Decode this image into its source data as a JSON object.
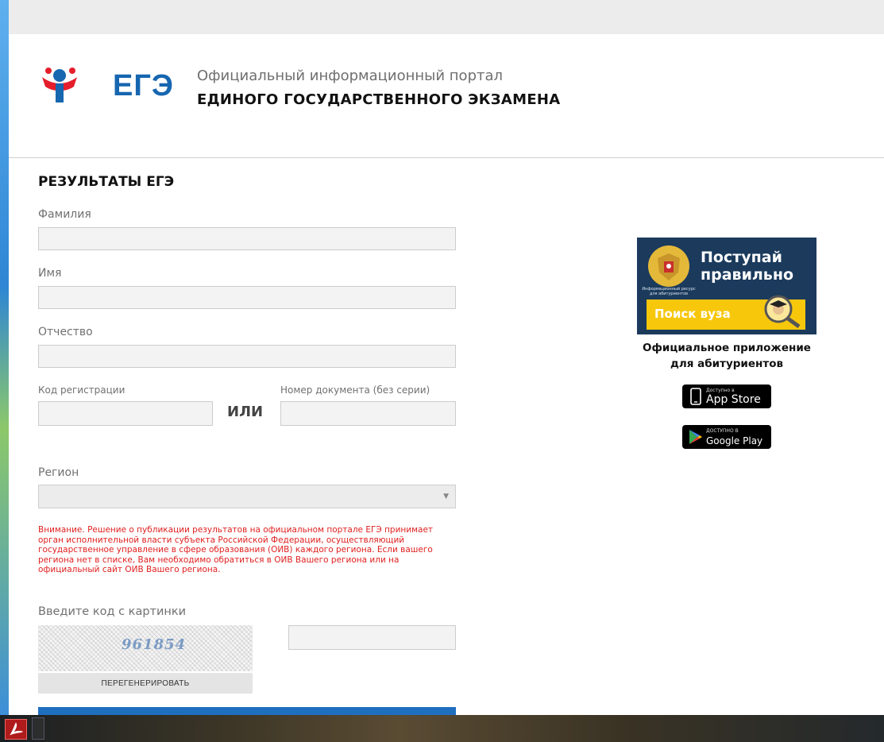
{
  "header": {
    "logo_text": "ЕГЭ",
    "portal_line1": "Официальный информационный портал",
    "portal_line2": "ЕДИНОГО ГОСУДАРСТВЕННОГО ЭКЗАМЕНА"
  },
  "form": {
    "title": "РЕЗУЛЬТАТЫ ЕГЭ",
    "surname_label": "Фамилия",
    "surname_value": "",
    "name_label": "Имя",
    "name_value": "",
    "patronymic_label": "Отчество",
    "patronymic_value": "",
    "reg_code_label": "Код регистрации",
    "reg_code_value": "",
    "or_text": "ИЛИ",
    "doc_number_label": "Номер документа (без серии)",
    "doc_number_value": "",
    "region_label": "Регион",
    "region_selected": "",
    "warning": "Внимание. Решение о публикации результатов на официальном портале ЕГЭ принимает орган исполнительной власти субъекта Российской Федерации, осуществляющий государственное управление в сфере образования (ОИВ) каждого региона. Если вашего региона нет в списке, Вам необходимо обратиться в ОИВ Вашего региона или на официальный сайт ОИВ Вашего региона.",
    "captcha_label": "Введите код с картинки",
    "captcha_code": "961854",
    "captcha_value": "",
    "regenerate_label": "ПЕРЕГЕНЕРИРОВАТЬ"
  },
  "sidebar": {
    "banner_title_line1": "Поступай",
    "banner_title_line2": "правильно",
    "banner_emblem_text": "Информационный ресурс для абитуриентов",
    "banner_button": "Поиск вуза",
    "app_caption_line1": "Официальное приложение",
    "app_caption_line2": "для абитуриентов",
    "appstore_small": "Доступно в",
    "appstore_big": "App Store",
    "googleplay_small": "ДОСТУПНО В",
    "googleplay_big": "Google Play"
  },
  "colors": {
    "brand_blue": "#1666b0",
    "brand_red": "#e41e2b",
    "warning_red": "#e02020",
    "banner_bg": "#1b3a5c",
    "banner_yellow": "#f7c70c"
  },
  "icons": [
    "ege-logo-icon",
    "gerb-emblem-icon",
    "magnifier-graduate-icon",
    "apple-phone-icon",
    "google-play-icon",
    "acrobat-icon"
  ]
}
